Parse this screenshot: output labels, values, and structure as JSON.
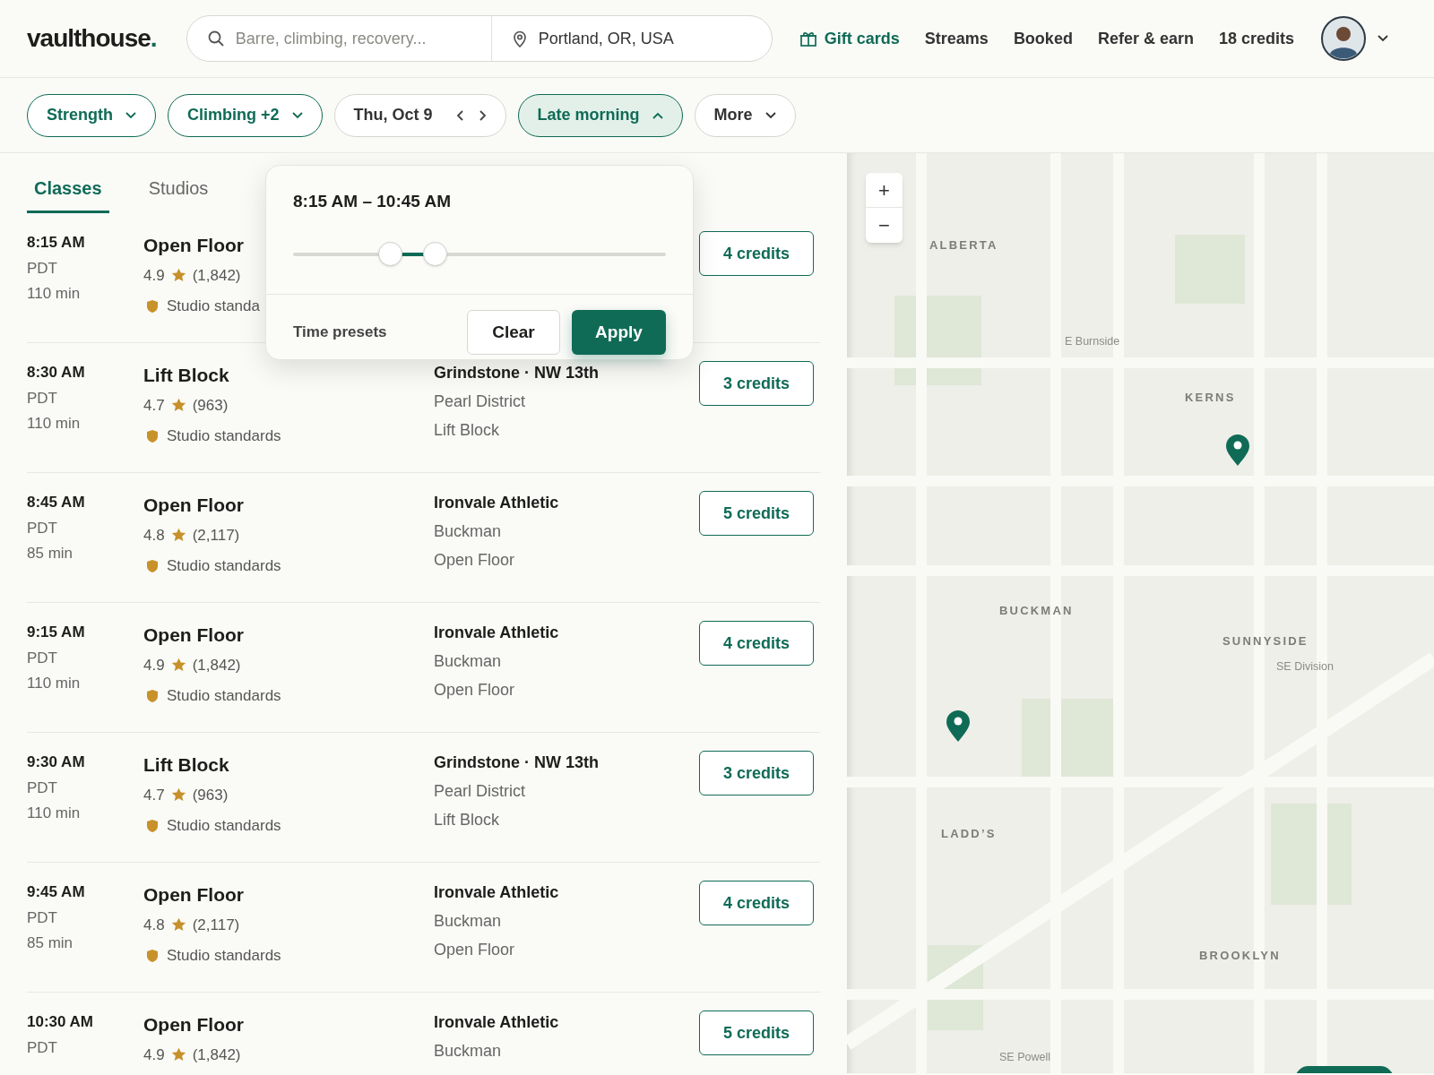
{
  "header": {
    "logo": "vaulthouse",
    "logo_dot": ".",
    "search": {
      "placeholder": "Barre, climbing, recovery..."
    },
    "location": {
      "value": "Portland, OR, USA"
    },
    "nav": [
      {
        "label": "Gift cards",
        "kind": "gift"
      },
      {
        "label": "Streams",
        "kind": "plain"
      },
      {
        "label": "Booked",
        "kind": "plain"
      },
      {
        "label": "Refer & earn",
        "kind": "plain"
      },
      {
        "label": "18 credits",
        "kind": "plain"
      }
    ]
  },
  "filters": [
    {
      "label": "Strength",
      "active": true,
      "kind": "dropdown",
      "expanded": false
    },
    {
      "label": "Climbing +2",
      "active": true,
      "kind": "dropdown",
      "expanded": false
    },
    {
      "label": "Thu, Oct 9",
      "active": false,
      "kind": "date",
      "expanded": false
    },
    {
      "label": "Late morning",
      "active": true,
      "kind": "dropdown",
      "expanded": true
    },
    {
      "label": "More",
      "active": false,
      "kind": "dropdown",
      "expanded": false
    }
  ],
  "tabs": [
    {
      "label": "Classes",
      "selected": true
    },
    {
      "label": "Studios",
      "selected": false
    }
  ],
  "time_popup": {
    "range": "8:15 AM – 10:45 AM",
    "thumbs": [
      {
        "level": 0.26
      },
      {
        "level": 0.38
      }
    ],
    "presets": "Time presets",
    "buttons": [
      "Clear",
      "Apply"
    ]
  },
  "classes": [
    {
      "time": "8:15 AM",
      "zone": "PDT",
      "duration": "110 min",
      "title": "Open Floor",
      "rating": "4.9",
      "reviews": "(1,842)",
      "badge": "Studio standa",
      "credits": "4 credits"
    },
    {
      "time": "8:30 AM",
      "zone": "PDT",
      "duration": "110 min",
      "title": "Lift Block",
      "rating": "4.7",
      "reviews": "(963)",
      "badge": "Studio standards",
      "studio": "Grindstone · NW 13th",
      "area": "Pearl District",
      "room": "Lift Block",
      "credits": "3 credits"
    },
    {
      "time": "8:45 AM",
      "zone": "PDT",
      "duration": "85 min",
      "title": "Open Floor",
      "rating": "4.8",
      "reviews": "(2,117)",
      "badge": "Studio standards",
      "studio": "Ironvale Athletic",
      "area": "Buckman",
      "room": "Open Floor",
      "credits": "5 credits"
    },
    {
      "time": "9:15 AM",
      "zone": "PDT",
      "duration": "110 min",
      "title": "Open Floor",
      "rating": "4.9",
      "reviews": "(1,842)",
      "badge": "Studio standards",
      "studio": "Ironvale Athletic",
      "area": "Buckman",
      "room": "Open Floor",
      "credits": "4 credits"
    },
    {
      "time": "9:30 AM",
      "zone": "PDT",
      "duration": "110 min",
      "title": "Lift Block",
      "rating": "4.7",
      "reviews": "(963)",
      "badge": "Studio standards",
      "studio": "Grindstone · NW 13th",
      "area": "Pearl District",
      "room": "Lift Block",
      "credits": "3 credits"
    },
    {
      "time": "9:45 AM",
      "zone": "PDT",
      "duration": "85 min",
      "title": "Open Floor",
      "rating": "4.8",
      "reviews": "(2,117)",
      "badge": "Studio standards",
      "studio": "Ironvale Athletic",
      "area": "Buckman",
      "room": "Open Floor",
      "credits": "4 credits"
    },
    {
      "time": "10:30 AM",
      "zone": "PDT",
      "title": "Open Floor",
      "rating": "4.9",
      "reviews": "(1,842)",
      "studio": "Ironvale Athletic",
      "area": "Buckman",
      "credits": "5 credits"
    }
  ],
  "map": {
    "zoom_in": "+",
    "zoom_out": "−",
    "labels": [
      {
        "text": "ALBERTA",
        "kind": "district"
      },
      {
        "text": "E Burnside",
        "kind": "street"
      },
      {
        "text": "KERNS",
        "kind": "district"
      },
      {
        "text": "BUCKMAN",
        "kind": "district"
      },
      {
        "text": "SUNNYSIDE",
        "kind": "district"
      },
      {
        "text": "SE Division",
        "kind": "street"
      },
      {
        "text": "LADD’S",
        "kind": "district"
      },
      {
        "text": "BROOKLYN",
        "kind": "district"
      },
      {
        "text": "SE Powell",
        "kind": "street"
      }
    ]
  }
}
